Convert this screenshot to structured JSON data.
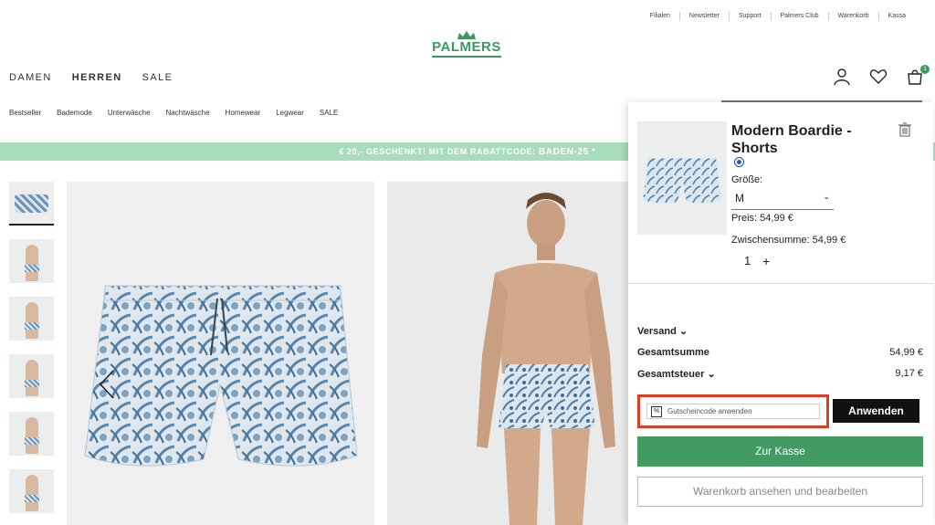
{
  "top_links": [
    "Filialen",
    "Newsletter",
    "Support",
    "Palmers Club",
    "Warenkorb",
    "Kassa"
  ],
  "brand": {
    "logo_text": "PALMERS",
    "color": "#3d9a5e"
  },
  "main_nav": [
    {
      "label": "DAMEN",
      "active": false
    },
    {
      "label": "HERREN",
      "active": true
    },
    {
      "label": "SALE",
      "active": false
    }
  ],
  "icons": {
    "account": "user-icon",
    "wishlist": "heart-icon",
    "cart": "shopping-bag-icon",
    "cart_count": "1"
  },
  "sub_nav": [
    "Bestseller",
    "Bademode",
    "Unterwäsche",
    "Nachtwäsche",
    "Homewear",
    "Legwear",
    "SALE"
  ],
  "promo": {
    "text": "€ 20,- GESCHENKT! MIT DEM RABATTCODE:",
    "code": "BADEN-25 *",
    "bg": "#a8dcbd"
  },
  "cart": {
    "product_title": "Modern Boardie - Shorts",
    "swatch_color": "#2757b8",
    "size_label": "Größe:",
    "size_value": "M",
    "price": "Preis:  54,99 €",
    "subtotal": "Zwischensumme:  54,99 €",
    "quantity": "1",
    "plus": "+",
    "shipping_label": "Versand",
    "total_label": "Gesamtsumme",
    "total_value": "54,99 €",
    "tax_label": "Gesamtsteuer",
    "tax_value": "9,17 €",
    "coupon_placeholder": "Gutscheincode anwenden",
    "coupon_icon": "%",
    "apply_button": "Anwenden",
    "checkout_button": "Zur Kasse",
    "view_cart_button": "Warenkorb ansehen und bearbeiten"
  }
}
